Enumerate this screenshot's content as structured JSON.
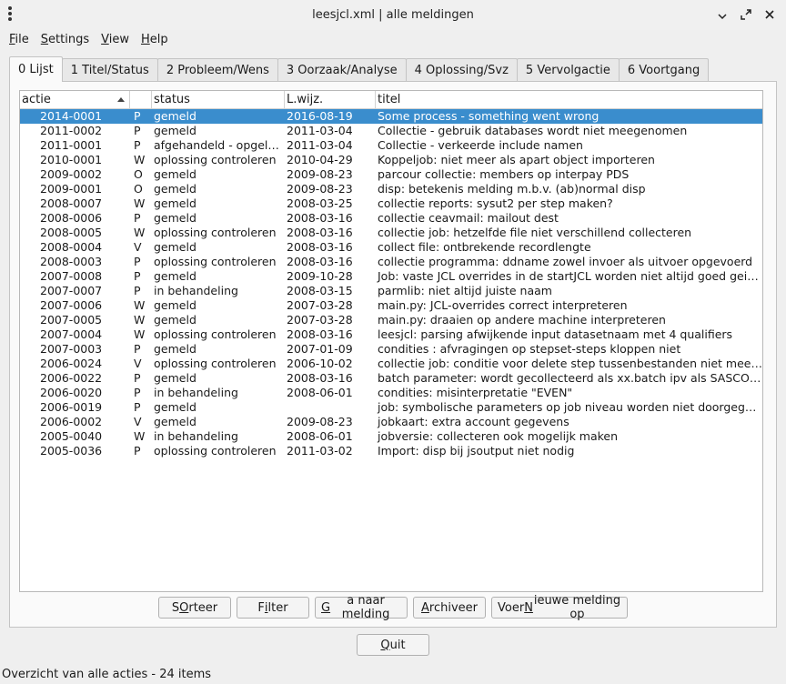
{
  "window": {
    "title": "leesjcl.xml | alle meldingen"
  },
  "menu": [
    {
      "label": "File",
      "mnemonic": "F",
      "rest": "ile"
    },
    {
      "label": "Settings",
      "mnemonic": "S",
      "rest": "ettings"
    },
    {
      "label": "View",
      "mnemonic": "V",
      "rest": "iew"
    },
    {
      "label": "Help",
      "mnemonic": "H",
      "rest": "elp"
    }
  ],
  "tabs": [
    {
      "label": "0 Lijst",
      "active": true
    },
    {
      "label": "1 Titel/Status"
    },
    {
      "label": "2 Probleem/Wens"
    },
    {
      "label": "3 Oorzaak/Analyse"
    },
    {
      "label": "4 Oplossing/Svz"
    },
    {
      "label": "5 Vervolgactie"
    },
    {
      "label": "6 Voortgang"
    }
  ],
  "table": {
    "columns": [
      "actie",
      "",
      "status",
      "L.wijz.",
      "titel"
    ],
    "rows": [
      [
        "2014-0001",
        "P",
        "gemeld",
        "2016-08-19",
        "Some process - something went wrong"
      ],
      [
        "2011-0002",
        "P",
        "gemeld",
        "2011-03-04",
        "Collectie - gebruik databases wordt niet meegenomen"
      ],
      [
        "2011-0001",
        "P",
        "afgehandeld - opgelost",
        "2011-03-04",
        "Collectie - verkeerde include namen"
      ],
      [
        "2010-0001",
        "W",
        "oplossing controleren",
        "2010-04-29",
        "Koppeljob: niet meer als apart object importeren"
      ],
      [
        "2009-0002",
        "O",
        "gemeld",
        "2009-08-23",
        "parcour collectie: members op interpay PDS"
      ],
      [
        "2009-0001",
        "O",
        "gemeld",
        "2009-08-23",
        "disp: betekenis melding m.b.v. (ab)normal disp"
      ],
      [
        "2008-0007",
        "W",
        "gemeld",
        "2008-03-25",
        "collectie reports: sysut2 per step maken?"
      ],
      [
        "2008-0006",
        "P",
        "gemeld",
        "2008-03-16",
        "collectie ceavmail: mailout dest"
      ],
      [
        "2008-0005",
        "W",
        "oplossing controleren",
        "2008-03-16",
        "collectie job: hetzelfde file niet verschillend collecteren"
      ],
      [
        "2008-0004",
        "V",
        "gemeld",
        "2008-03-16",
        "collect file: ontbrekende recordlengte"
      ],
      [
        "2008-0003",
        "P",
        "oplossing controleren",
        "2008-03-16",
        "collectie programma: ddname zowel invoer als uitvoer opgevoerd"
      ],
      [
        "2007-0008",
        "P",
        "gemeld",
        "2009-10-28",
        "Job: vaste JCL overrides in de startJCL worden niet altijd goed geinterpreteerd"
      ],
      [
        "2007-0007",
        "P",
        "in behandeling",
        "2008-03-15",
        "parmlib: niet altijd juiste naam"
      ],
      [
        "2007-0006",
        "W",
        "gemeld",
        "2007-03-28",
        "main.py: JCL-overrides correct interpreteren"
      ],
      [
        "2007-0005",
        "W",
        "gemeld",
        "2007-03-28",
        "main.py: draaien op andere machine interpreteren"
      ],
      [
        "2007-0004",
        "W",
        "oplossing controleren",
        "2008-03-16",
        "leesjcl: parsing afwijkende input datasetnaam met 4 qualifiers"
      ],
      [
        "2007-0003",
        "P",
        "gemeld",
        "2007-01-09",
        "condities : afvragingen op stepset-steps kloppen niet"
      ],
      [
        "2006-0024",
        "V",
        "oplossing controleren",
        "2006-10-02",
        "collectie job: conditie voor delete step tussenbestanden niet meegenomen"
      ],
      [
        "2006-0022",
        "P",
        "gemeld",
        "2008-03-16",
        "batch parameter: wordt gecollecteerd als xx.batch ipv als SASCONFIG"
      ],
      [
        "2006-0020",
        "P",
        "in behandeling",
        "2008-06-01",
        "condities: misinterpretatie \"EVEN\""
      ],
      [
        "2006-0019",
        "P",
        "gemeld",
        "",
        "job: symbolische parameters op job niveau worden niet doorgegeven"
      ],
      [
        "2006-0002",
        "V",
        "gemeld",
        "2009-08-23",
        "jobkaart: extra account gegevens"
      ],
      [
        "2005-0040",
        "W",
        "in behandeling",
        "2008-06-01",
        "jobversie: collecteren ook mogelijk maken"
      ],
      [
        "2005-0036",
        "P",
        "oplossing controleren",
        "2011-03-02",
        "Import: disp bij jsoutput niet nodig"
      ]
    ],
    "selected_row": 0
  },
  "buttons": {
    "sorteer": {
      "pre": "S",
      "mn": "O",
      "post": "rteer"
    },
    "filter": {
      "pre": "F",
      "mn": "i",
      "post": "lter"
    },
    "ganaar": {
      "pre": "",
      "mn": "G",
      "post": "a naar melding"
    },
    "archiveer": {
      "pre": "",
      "mn": "A",
      "post": "rchiveer"
    },
    "voer": {
      "pre": "Voer ",
      "mn": "N",
      "post": "ieuwe melding op"
    },
    "quit": {
      "pre": "",
      "mn": "Q",
      "post": "uit"
    }
  },
  "status_text": "Overzicht van alle acties - 24 items",
  "colors": {
    "selection": "#3a8dcd",
    "background": "#efefef"
  }
}
